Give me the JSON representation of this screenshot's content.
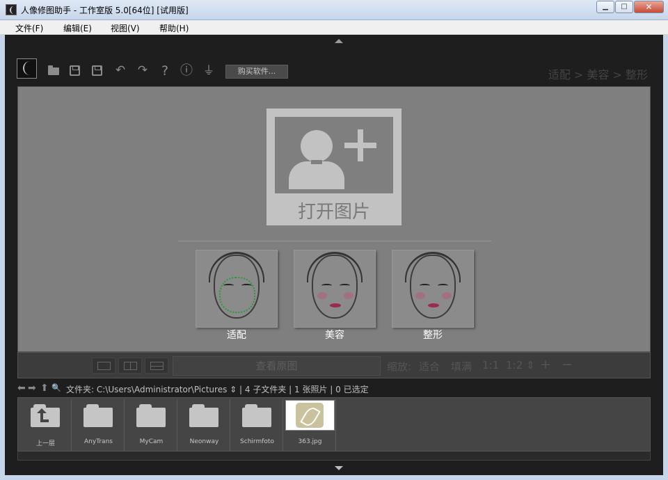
{
  "window": {
    "title": "人像修图助手 - 工作室版 5.0[64位] [试用版]",
    "min_glyph": "▁",
    "max_glyph": "□",
    "close_glyph": "✕"
  },
  "menu": {
    "items": [
      "文件(F)",
      "编辑(E)",
      "视图(V)",
      "帮助(H)"
    ]
  },
  "toolbar": {
    "buy_label": "购买软件...",
    "breadcrumb": "适配 > 美容 > 整形",
    "icons": [
      "logo-icon",
      "open-folder-icon",
      "save-icon",
      "save-as-icon",
      "undo-icon",
      "redo-icon",
      "help-icon",
      "info-icon",
      "plugin-icon"
    ],
    "undo_glyph": "↶",
    "redo_glyph": "↷",
    "help_glyph": "?",
    "info_glyph": "ⓘ",
    "plugin_glyph": "⏚"
  },
  "main": {
    "open_label": "打开图片",
    "features": [
      {
        "label": "适配",
        "icon": "face-landmarks-icon"
      },
      {
        "label": "美容",
        "icon": "face-beauty-icon"
      },
      {
        "label": "整形",
        "icon": "face-reshape-icon"
      }
    ]
  },
  "zoom_bar": {
    "view_original": "查看原图",
    "zoom_label": "缩放:",
    "options": [
      "适合",
      "填满",
      "1:1",
      "1:2"
    ],
    "spinner_glyph": "⇕",
    "zoom_in": "+",
    "zoom_out": "−"
  },
  "path_bar": {
    "glyphs": [
      "⬅",
      "➡",
      "⬆",
      "🔍"
    ],
    "text": "文件夹: C:\\Users\\Administrator\\Pictures ⇕ | 4 子文件夹 | 1 张照片 | 0 已选定"
  },
  "thumbnails": [
    {
      "label": "上一层",
      "kind": "parent"
    },
    {
      "label": "AnyTrans",
      "kind": "folder"
    },
    {
      "label": "MyCam",
      "kind": "folder"
    },
    {
      "label": "Neonway",
      "kind": "folder"
    },
    {
      "label": "Schirmfoto",
      "kind": "folder"
    },
    {
      "label": "363.jpg",
      "kind": "image"
    }
  ],
  "colors": {
    "title_gradient_top": "#dfe9f5",
    "workspace_bg": "#1e1e1e",
    "canvas_bg": "#7f7f7f",
    "icon_gray": "#8c8c8c"
  }
}
